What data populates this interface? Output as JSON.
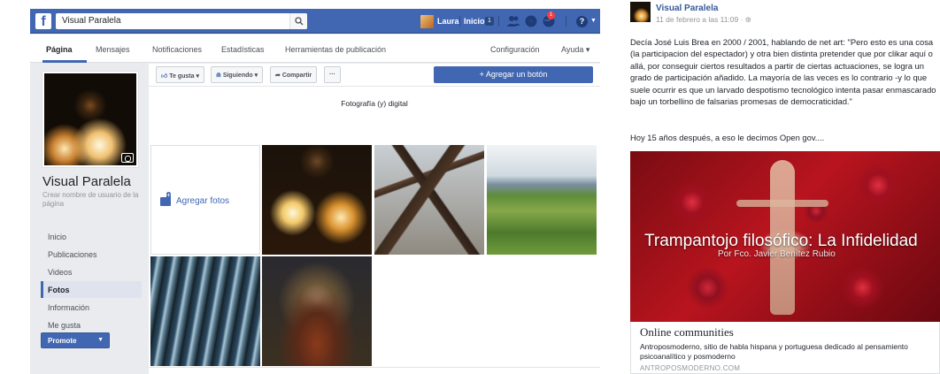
{
  "topbar": {
    "logo": "f",
    "search_value": "Visual Paralela",
    "user_name": "Laura",
    "home_label": "Inicio",
    "home_count": "1",
    "notif_count": "1"
  },
  "page_tabs": [
    {
      "label": "Página",
      "active": true
    },
    {
      "label": "Mensajes"
    },
    {
      "label": "Notificaciones"
    },
    {
      "label": "Estadísticas"
    },
    {
      "label": "Herramientas de publicación"
    },
    {
      "label": "Configuración"
    },
    {
      "label": "Ayuda ▾"
    }
  ],
  "profile": {
    "page_name": "Visual Paralela",
    "username_hint": "Crear nombre de usuario de la página"
  },
  "side_nav": [
    {
      "label": "Inicio"
    },
    {
      "label": "Publicaciones"
    },
    {
      "label": "Videos"
    },
    {
      "label": "Fotos",
      "active": true
    },
    {
      "label": "Información"
    },
    {
      "label": "Me gusta"
    }
  ],
  "promote_label": "Promote",
  "actions": {
    "like": "Te gusta ▾",
    "follow": "Siguiendo ▾",
    "share": "Compartir",
    "more": "···",
    "cta": "+ Agregar un botón"
  },
  "cover_caption": "Fotografía (y) digital",
  "add_photos_label": "Agregar fotos",
  "post": {
    "author": "Visual Paralela",
    "meta": "11 de febrero a las 11:09 · ⊛",
    "body": "Decía José Luis Brea en 2000 / 2001, hablando de net art: \"Pero esto es una cosa (la participacion del espectador) y otra bien distinta pretender que por clikar aquí o allá, por conseguir ciertos resultados a partir de ciertas actuaciones, se logra un grado de participación añadido. La mayoría de las veces es lo contrario -y lo que suele ocurrir es que un larvado despotismo tecnológico intenta pasar enmascarado bajo un torbellino de falsarias promesas de democraticidad.\"",
    "body2": "Hoy 15 años después, a eso le decimos Open gov....",
    "link_image_title": "Trampantojo filosófico: La Infidelidad",
    "link_image_subtitle": "Por Fco. Javier Benítez Rubio",
    "link_headline": "Online communities",
    "link_description": "Antroposmoderno, sitio de habla hispana y portuguesa dedicado al pensamiento psicoanalítico y posmoderno",
    "link_domain": "ANTROPOSMODERNO.COM"
  },
  "colors": {
    "fb_blue": "#4267b2",
    "link_blue": "#365899",
    "page_bg": "#e9ebee"
  }
}
